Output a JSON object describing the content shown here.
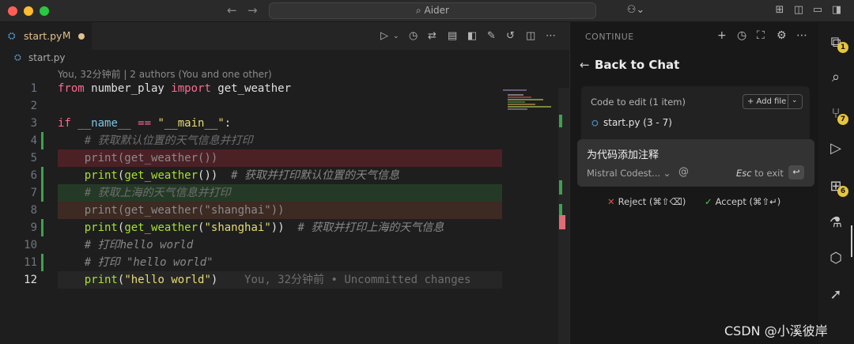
{
  "titlebar": {
    "search_text": "⌕ Aider"
  },
  "tab": {
    "name": "start.py",
    "modified": "M"
  },
  "breadcrumb": {
    "file": "start.py"
  },
  "codelens": "You, 32分钟前 | 2 authors (You and one other)",
  "code_lines": [
    {
      "num": "1",
      "parts": [
        [
          "kw",
          "from"
        ],
        [
          "plain",
          " number_play "
        ],
        [
          "kw",
          "import"
        ],
        [
          "plain",
          " get_weather"
        ]
      ]
    },
    {
      "num": "2",
      "parts": []
    },
    {
      "num": "3",
      "parts": [
        [
          "kw",
          "if"
        ],
        [
          "plain",
          " "
        ],
        [
          "dunder",
          "__name__"
        ],
        [
          "plain",
          " "
        ],
        [
          "kw",
          "=="
        ],
        [
          "plain",
          " "
        ],
        [
          "str",
          "\"__main__\""
        ],
        [
          "plain",
          ":"
        ]
      ]
    },
    {
      "num": "4",
      "parts": [
        [
          "cm-dim",
          "    # 获取默认位置的天气信息并打印"
        ]
      ]
    },
    {
      "num": "5",
      "parts": [
        [
          "dim",
          "    print(get_weather())"
        ]
      ]
    },
    {
      "num": "6",
      "parts": [
        [
          "plain",
          "    "
        ],
        [
          "fn",
          "print"
        ],
        [
          "plain",
          "("
        ],
        [
          "fn",
          "get_weather"
        ],
        [
          "plain",
          "())"
        ],
        [
          "cm",
          "  # 获取并打印默认位置的天气信息"
        ]
      ]
    },
    {
      "num": "7",
      "parts": [
        [
          "cm-dim",
          "    # 获取上海的天气信息并打印"
        ]
      ]
    },
    {
      "num": "8",
      "parts": [
        [
          "dim",
          "    print(get_weather(\"shanghai\"))"
        ]
      ]
    },
    {
      "num": "9",
      "parts": [
        [
          "plain",
          "    "
        ],
        [
          "fn",
          "print"
        ],
        [
          "plain",
          "("
        ],
        [
          "fn",
          "get_weather"
        ],
        [
          "plain",
          "("
        ],
        [
          "str",
          "\"shanghai\""
        ],
        [
          "plain",
          "))"
        ],
        [
          "cm",
          "  # 获取并打印上海的天气信息"
        ]
      ]
    },
    {
      "num": "10",
      "parts": [
        [
          "cm",
          "    # 打印hello world"
        ]
      ]
    },
    {
      "num": "11",
      "parts": [
        [
          "cm",
          "    # 打印 \"hello world\""
        ]
      ]
    },
    {
      "num": "12",
      "parts": [
        [
          "plain",
          "    "
        ],
        [
          "fn",
          "print"
        ],
        [
          "plain",
          "("
        ],
        [
          "str",
          "\"hello world\""
        ],
        [
          "plain",
          ")"
        ],
        [
          "ghost",
          "    You, 32分钟前 • Uncommitted changes"
        ]
      ]
    }
  ],
  "panel": {
    "title": "CONTINUE",
    "back_title": "Back to Chat",
    "code_to_edit": "Code to edit (1 item)",
    "add_file": "+ Add file",
    "file_item": "start.py (3 - 7)",
    "prompt": "为代码添加注释",
    "model": "Mistral Codest... ⌄",
    "esc_key": "Esc",
    "esc_suffix": " to exit",
    "reject": "Reject (⌘⇧⌫)",
    "accept": "Accept (⌘⇧↵)"
  },
  "activity": {
    "badges": [
      "1",
      "7",
      "6"
    ]
  },
  "watermark": "CSDN @小溪彼岸"
}
